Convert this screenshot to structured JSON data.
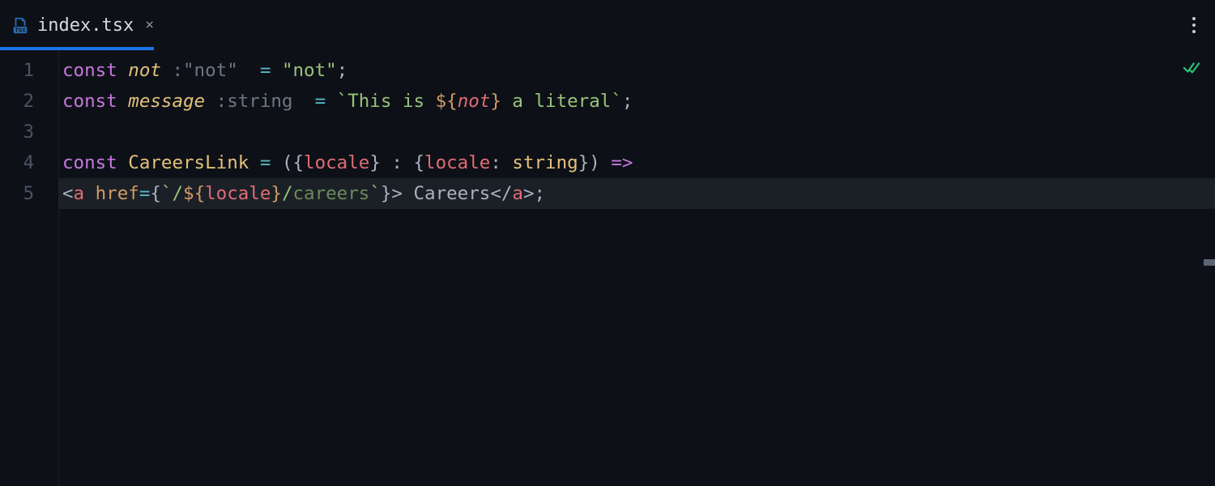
{
  "tab": {
    "filename": "index.tsx",
    "icon_name": "tsx-file-icon",
    "close_glyph": "×"
  },
  "gutter": {
    "line_numbers": [
      "1",
      "2",
      "3",
      "4",
      "5"
    ]
  },
  "code": {
    "l1": {
      "kw_const": "const ",
      "name": "not",
      "type_sep": " :",
      "type_value": "\"not\" ",
      "eq": " = ",
      "str": "\"not\"",
      "semi": ";"
    },
    "l2": {
      "kw_const": "const ",
      "name": "message",
      "type_sep": " :",
      "type_value": "string ",
      "eq": " = ",
      "tick_open": "`",
      "txt_a": "This is ",
      "dollar": "$",
      "brace_open": "{",
      "var": "not",
      "brace_close": "}",
      "txt_b": " a literal",
      "tick_close": "`",
      "semi": ";"
    },
    "l4": {
      "kw_const": "const ",
      "name": "CareersLink",
      "eq": " = ",
      "paren_open": "(",
      "brace_open": "{",
      "param": "locale",
      "brace_close": "}",
      "colon": " : ",
      "type_brace_open": "{",
      "type_key": "locale",
      "type_colon": ": ",
      "type_val": "string",
      "type_brace_close": "}",
      "paren_close": ")",
      "arrow": " =>"
    },
    "l5": {
      "lt": "<",
      "tag_a": "a",
      "space": " ",
      "attr": "href",
      "eq": "=",
      "jsx_brace_open": "{",
      "tick_open": "`",
      "slash1": "/",
      "dollar": "$",
      "ibrace_open": "{",
      "var": "locale",
      "ibrace_close": "}",
      "slash2": "/",
      "path": "careers",
      "tick_close": "`",
      "jsx_brace_close": "}",
      "gt": ">",
      "content": " Careers",
      "lt2": "</",
      "tag_a2": "a",
      "gt2": ">",
      "semi": ";"
    }
  },
  "current_line": 5
}
